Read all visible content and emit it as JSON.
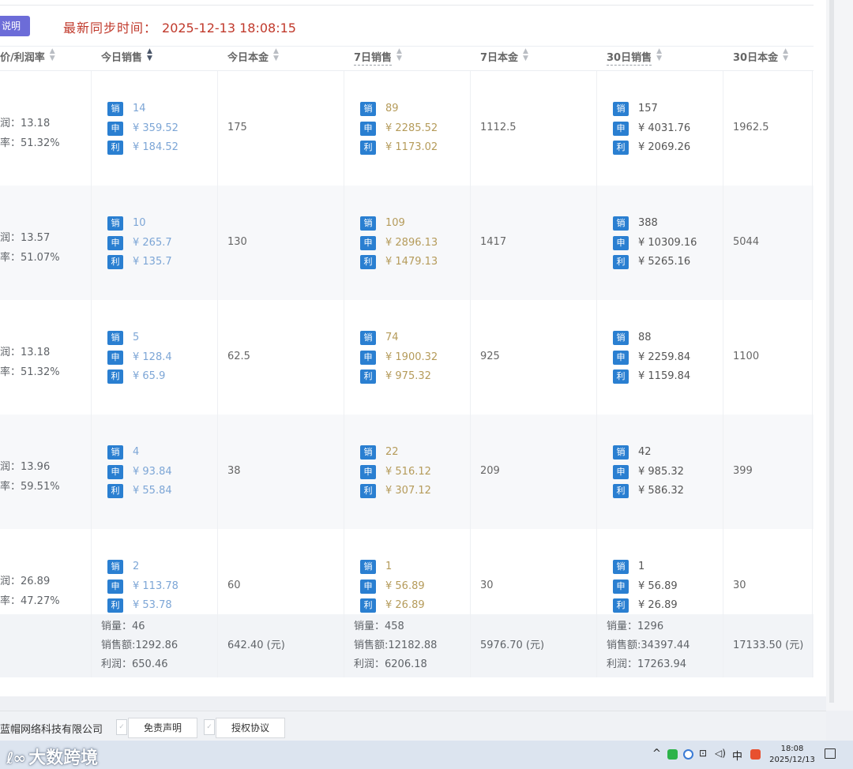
{
  "header": {
    "info_button": "说明",
    "sync_label": "最新同步时间：",
    "sync_time": "2025-12-13 18:08:15"
  },
  "columns": [
    {
      "label": "价/利润率"
    },
    {
      "label": "今日销售"
    },
    {
      "label": "今日本金"
    },
    {
      "label": "7日销售"
    },
    {
      "label": "7日本金"
    },
    {
      "label": "30日销售"
    },
    {
      "label": "30日本金"
    }
  ],
  "badges": {
    "sales": "销",
    "amount": "申",
    "profit": "利"
  },
  "rows": [
    {
      "profit_label": "润：13.18",
      "rate_label": "率：51.32%",
      "today": {
        "qty": "14",
        "amount": "¥ 359.52",
        "profit": "¥ 184.52"
      },
      "today_cost": "175",
      "d7": {
        "qty": "89",
        "amount": "¥ 2285.52",
        "profit": "¥ 1173.02"
      },
      "d7_cost": "1112.5",
      "d30": {
        "qty": "157",
        "amount": "¥ 4031.76",
        "profit": "¥ 2069.26"
      },
      "d30_cost": "1962.5"
    },
    {
      "profit_label": "润：13.57",
      "rate_label": "率：51.07%",
      "today": {
        "qty": "10",
        "amount": "¥ 265.7",
        "profit": "¥ 135.7"
      },
      "today_cost": "130",
      "d7": {
        "qty": "109",
        "amount": "¥ 2896.13",
        "profit": "¥ 1479.13"
      },
      "d7_cost": "1417",
      "d30": {
        "qty": "388",
        "amount": "¥ 10309.16",
        "profit": "¥ 5265.16"
      },
      "d30_cost": "5044"
    },
    {
      "profit_label": "润：13.18",
      "rate_label": "率：51.32%",
      "today": {
        "qty": "5",
        "amount": "¥ 128.4",
        "profit": "¥ 65.9"
      },
      "today_cost": "62.5",
      "d7": {
        "qty": "74",
        "amount": "¥ 1900.32",
        "profit": "¥ 975.32"
      },
      "d7_cost": "925",
      "d30": {
        "qty": "88",
        "amount": "¥ 2259.84",
        "profit": "¥ 1159.84"
      },
      "d30_cost": "1100"
    },
    {
      "profit_label": "润：13.96",
      "rate_label": "率：59.51%",
      "today": {
        "qty": "4",
        "amount": "¥ 93.84",
        "profit": "¥ 55.84"
      },
      "today_cost": "38",
      "d7": {
        "qty": "22",
        "amount": "¥ 516.12",
        "profit": "¥ 307.12"
      },
      "d7_cost": "209",
      "d30": {
        "qty": "42",
        "amount": "¥ 985.32",
        "profit": "¥ 586.32"
      },
      "d30_cost": "399"
    },
    {
      "profit_label": "润：26.89",
      "rate_label": "率：47.27%",
      "today": {
        "qty": "2",
        "amount": "¥ 113.78",
        "profit": "¥ 53.78"
      },
      "today_cost": "60",
      "d7": {
        "qty": "1",
        "amount": "¥ 56.89",
        "profit": "¥ 26.89"
      },
      "d7_cost": "30",
      "d30": {
        "qty": "1",
        "amount": "¥ 56.89",
        "profit": "¥ 26.89"
      },
      "d30_cost": "30"
    }
  ],
  "summary": {
    "today": {
      "qty": "销量：46",
      "amount": "销售额:1292.86",
      "profit": "利润：650.46"
    },
    "today_cost": "642.40 (元)",
    "d7": {
      "qty": "销量：458",
      "amount": "销售额:12182.88",
      "profit": "利润：6206.18"
    },
    "d7_cost": "5976.70 (元)",
    "d30": {
      "qty": "销量：1296",
      "amount": "销售额:34397.44",
      "profit": "利润：17263.94"
    },
    "d30_cost": "17133.50 (元)"
  },
  "footer": {
    "company": "蓝帽网络科技有限公司",
    "disclaimer": "免责声明",
    "license": "授权协议"
  },
  "taskbar": {
    "watermark": "大数跨境",
    "ime": "中",
    "time": "18:08",
    "date": "2025/12/13"
  },
  "colors": {
    "sync_red": "#c0392b",
    "badge_blue": "#2a7fd1",
    "info_purple": "#6c6cd8",
    "today_value_blue": "#7da6d6",
    "d7_value_gold": "#b59b5a"
  }
}
